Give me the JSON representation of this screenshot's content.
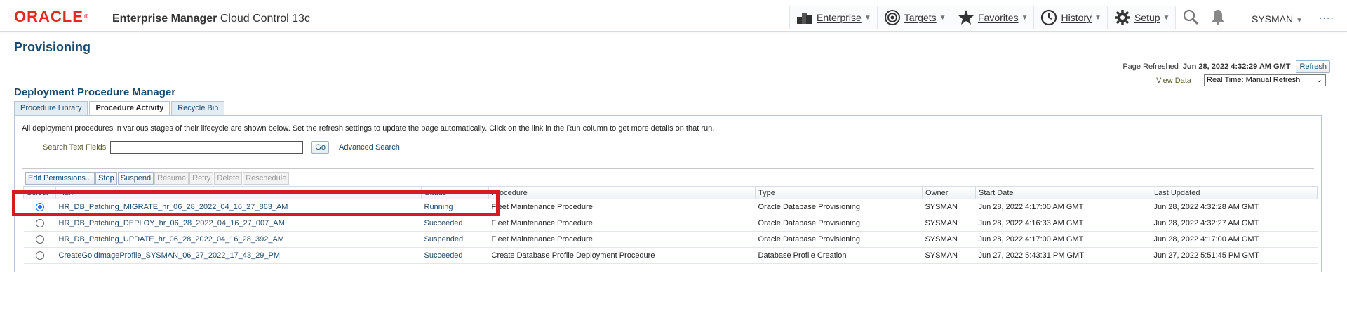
{
  "header": {
    "logo": "ORACLE",
    "product_bold": "Enterprise Manager",
    "product_rest": " Cloud Control 13c",
    "nav": [
      {
        "label": "Enterprise",
        "icon": "enterprise-icon"
      },
      {
        "label": "Targets",
        "icon": "targets-icon"
      },
      {
        "label": "Favorites",
        "icon": "star-icon"
      },
      {
        "label": "History",
        "icon": "clock-icon"
      },
      {
        "label": "Setup",
        "icon": "gear-icon"
      }
    ],
    "user": "SYSMAN",
    "more_dots": "····"
  },
  "page": {
    "title": "Provisioning",
    "refreshed_label": "Page Refreshed",
    "refreshed_time": "Jun 28, 2022 4:32:29 AM GMT",
    "refresh_button": "Refresh",
    "view_data_label": "View Data",
    "view_data_value": "Real Time: Manual Refresh"
  },
  "dpm": {
    "title": "Deployment Procedure Manager",
    "tabs": [
      "Procedure Library",
      "Procedure Activity",
      "Recycle Bin"
    ],
    "active_tab": "Procedure Activity",
    "description": "All deployment procedures in various stages of their lifecycle are shown below. Set the refresh settings to update the page automatically. Click on the link in the Run column to get more details on that run.",
    "search_label": "Search Text Fields",
    "search_value": "",
    "go_button": "Go",
    "advanced_search": "Advanced Search",
    "toolbar": [
      "Edit Permissions...",
      "Stop",
      "Suspend",
      "Resume",
      "Retry",
      "Delete",
      "Reschedule"
    ],
    "toolbar_disabled": [
      "Resume",
      "Retry",
      "Delete",
      "Reschedule"
    ],
    "columns": [
      "Select",
      "Run",
      "Status",
      "Procedure",
      "Type",
      "Owner",
      "Start Date",
      "Last Updated"
    ],
    "rows": [
      {
        "selected": true,
        "run": "HR_DB_Patching_MIGRATE_hr_06_28_2022_04_16_27_863_AM",
        "status": "Running",
        "procedure": "Fleet Maintenance Procedure",
        "type": "Oracle Database Provisioning",
        "owner": "SYSMAN",
        "start": "Jun 28, 2022 4:17:00 AM GMT",
        "updated": "Jun 28, 2022 4:32:28 AM GMT"
      },
      {
        "selected": false,
        "run": "HR_DB_Patching_DEPLOY_hr_06_28_2022_04_16_27_007_AM",
        "status": "Succeeded",
        "procedure": "Fleet Maintenance Procedure",
        "type": "Oracle Database Provisioning",
        "owner": "SYSMAN",
        "start": "Jun 28, 2022 4:16:33 AM GMT",
        "updated": "Jun 28, 2022 4:32:27 AM GMT"
      },
      {
        "selected": false,
        "run": "HR_DB_Patching_UPDATE_hr_06_28_2022_04_16_28_392_AM",
        "status": "Suspended",
        "procedure": "Fleet Maintenance Procedure",
        "type": "Oracle Database Provisioning",
        "owner": "SYSMAN",
        "start": "Jun 28, 2022 4:17:00 AM GMT",
        "updated": "Jun 28, 2022 4:17:00 AM GMT"
      },
      {
        "selected": false,
        "run": "CreateGoldImageProfile_SYSMAN_06_27_2022_17_43_29_PM",
        "status": "Succeeded",
        "procedure": "Create Database Profile Deployment Procedure",
        "type": "Database Profile Creation",
        "owner": "SYSMAN",
        "start": "Jun 27, 2022 5:43:31 PM GMT",
        "updated": "Jun 27, 2022 5:51:45 PM GMT"
      }
    ]
  },
  "colors": {
    "brand_red": "#e4281d",
    "title_blue": "#1c4a6c",
    "highlight_red": "#d61a1f",
    "radio_blue": "#1a73e8"
  }
}
